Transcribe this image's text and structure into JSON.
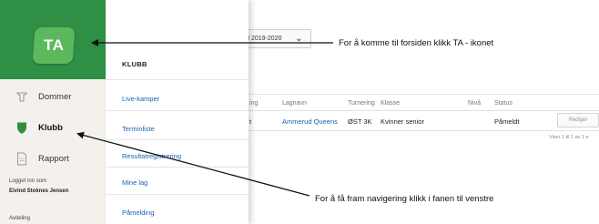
{
  "brand": {
    "logo_text": "TA",
    "color": "#2e8f45"
  },
  "sidebar": {
    "items": [
      {
        "label": "Dommer",
        "icon": "referee-whistle-icon"
      },
      {
        "label": "Klubb",
        "icon": "shield-icon",
        "active": true
      },
      {
        "label": "Rapport",
        "icon": "document-icon"
      }
    ],
    "logged_in_label": "Logget inn som",
    "user_name": "Eivind Stoknes Jensen",
    "department_label": "Avdeling"
  },
  "submenu": {
    "title": "KLUBB",
    "items": [
      "Live-kamper",
      "Terminliste",
      "Resultatregistrering",
      "Mine lag",
      "Påmelding"
    ]
  },
  "season": {
    "label": "N 2019-2020"
  },
  "table": {
    "headers": [
      "ing",
      "Lagnavn",
      "Turnering",
      "Klasse",
      "Nivå",
      "Status"
    ],
    "row": {
      "partial": "t",
      "team": "Ammerud Queens",
      "tournament": "ØST 3K",
      "class": "Kvinner senior",
      "status": "Påmeldt"
    },
    "edit_label": "Rediger",
    "footer": "Viser 1 til 1 av 1 e"
  },
  "annotations": {
    "top": "For å komme til forsiden klikk TA - ikonet",
    "bottom": "For å få fram navigering klikk i fanen til venstre"
  },
  "colors": {
    "link": "#1a5fb4",
    "accent_green": "#5cb85c",
    "sidebar_bg": "#f4f1ec"
  }
}
